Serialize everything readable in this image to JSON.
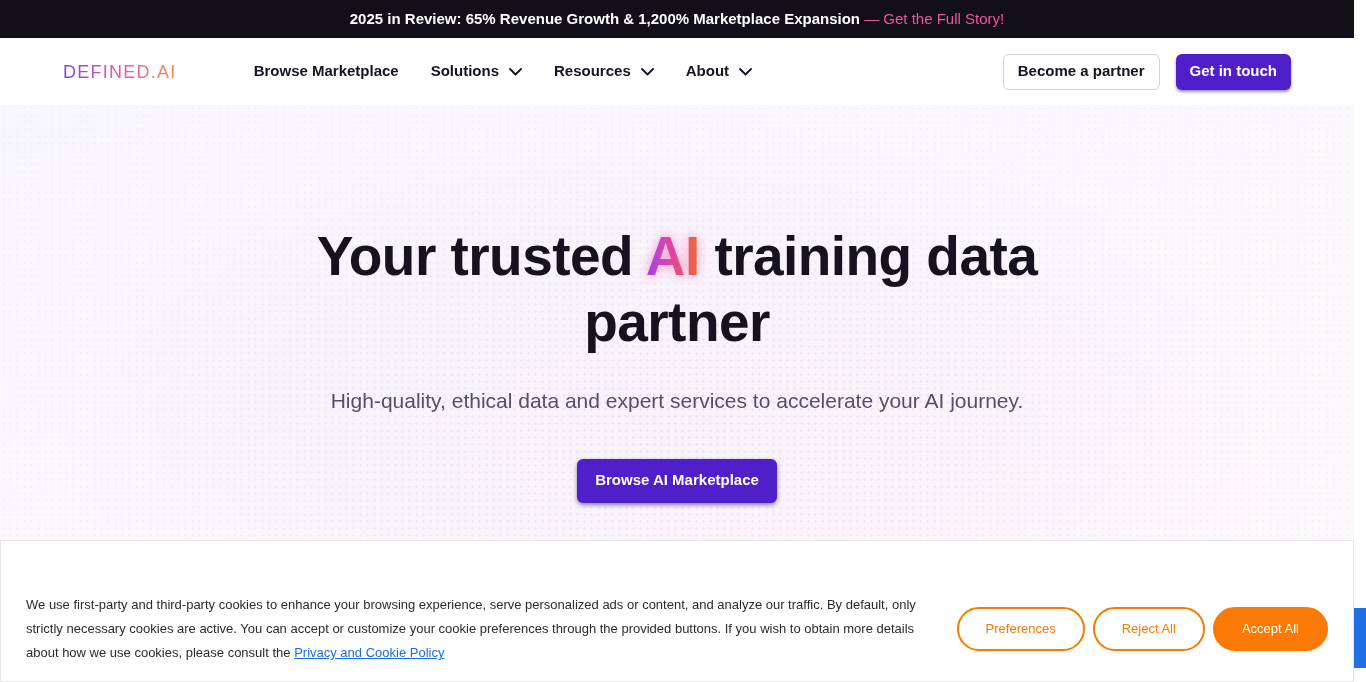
{
  "announcement": {
    "text": "2025 in Review: 65% Revenue Growth & 1,200% Marketplace Expansion",
    "link": "— Get the Full Story!"
  },
  "header": {
    "logo": "DEFINED.AI",
    "nav": [
      {
        "label": "Browse Marketplace",
        "kind": "link"
      },
      {
        "label": "Solutions",
        "kind": "dropdown"
      },
      {
        "label": "Resources",
        "kind": "dropdown"
      },
      {
        "label": "About",
        "kind": "dropdown"
      }
    ],
    "buttons": [
      {
        "label": "Become a partner",
        "kind": "outline"
      },
      {
        "label": "Get in touch",
        "kind": "primary"
      }
    ]
  },
  "hero": {
    "headline": {
      "before": "Your trusted",
      "highlight": "AI",
      "after": "training data partner"
    },
    "subtitle": "High-quality, ethical data and expert services to accelerate your AI journey.",
    "button": "Browse AI Marketplace"
  },
  "cookie_banner": {
    "text": "We use first-party and third-party cookies to enhance your browsing experience, serve personalized ads or content, and analyze our traffic. By default, only strictly necessary cookies are active. You can accept or customize your cookie preferences through the provided buttons. If you wish to obtain more details about how we use cookies, please consult the",
    "link": "Privacy and Cookie Policy",
    "buttons": [
      {
        "label": "Preferences",
        "kind": "outline"
      },
      {
        "label": "Reject All",
        "kind": "outline"
      },
      {
        "label": "Accept All",
        "kind": "filled"
      }
    ]
  }
}
